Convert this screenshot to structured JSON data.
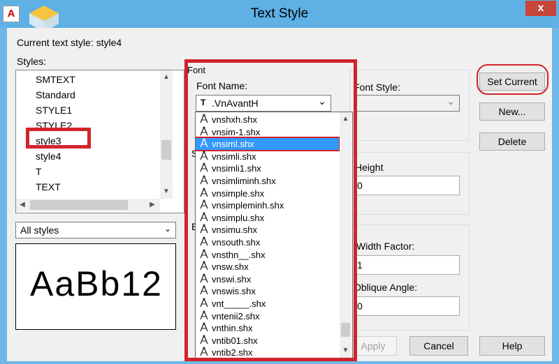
{
  "window": {
    "title": "Text Style",
    "close_label": "x",
    "app_icon_label": "A"
  },
  "current_style": {
    "label": "Current text style:",
    "value": "style4"
  },
  "styles": {
    "label": "Styles:",
    "items": [
      "SMTEXT",
      "Standard",
      "STYLE1",
      "STYLE2",
      "style3",
      "style4",
      "T",
      "TEXT"
    ],
    "selected": "style3"
  },
  "filter": {
    "value": "All styles"
  },
  "preview": {
    "text": "AaBb12"
  },
  "font": {
    "group_label": "Font",
    "name_label": "Font Name:",
    "selected_font": ".VnAvantH",
    "style_label": "Font Style:",
    "dropdown_items": [
      "vnshxh.shx",
      "vnsim-1.shx",
      "vnsiml.shx",
      "vnsimli.shx",
      "vnsimli1.shx",
      "vnsimliminh.shx",
      "vnsimple.shx",
      "vnsimpleminh.shx",
      "vnsimplu.shx",
      "vnsimu.shx",
      "vnsouth.shx",
      "vnsthn__.shx",
      "vnsw.shx",
      "vnswi.shx",
      "vnswis.shx",
      "vnt_____.shx",
      "vntenii2.shx",
      "vnthin.shx",
      "vntib01.shx",
      "vntib2.shx"
    ],
    "highlighted": "vnsiml.shx"
  },
  "size": {
    "height_label": "Height",
    "height_value": "0"
  },
  "effects": {
    "width_label": "Width Factor:",
    "width_value": "1",
    "oblique_label": "Oblique Angle:",
    "oblique_value": "0"
  },
  "partial_labels": {
    "size_letter": "S",
    "effects_letter": "E"
  },
  "buttons": {
    "set_current": "Set Current",
    "new": "New...",
    "delete": "Delete",
    "apply": "Apply",
    "cancel": "Cancel",
    "help": "Help"
  },
  "colors": {
    "title_bar": "#5eb0e5",
    "highlight": "#3399ff",
    "annotation_red": "#d2232a"
  }
}
